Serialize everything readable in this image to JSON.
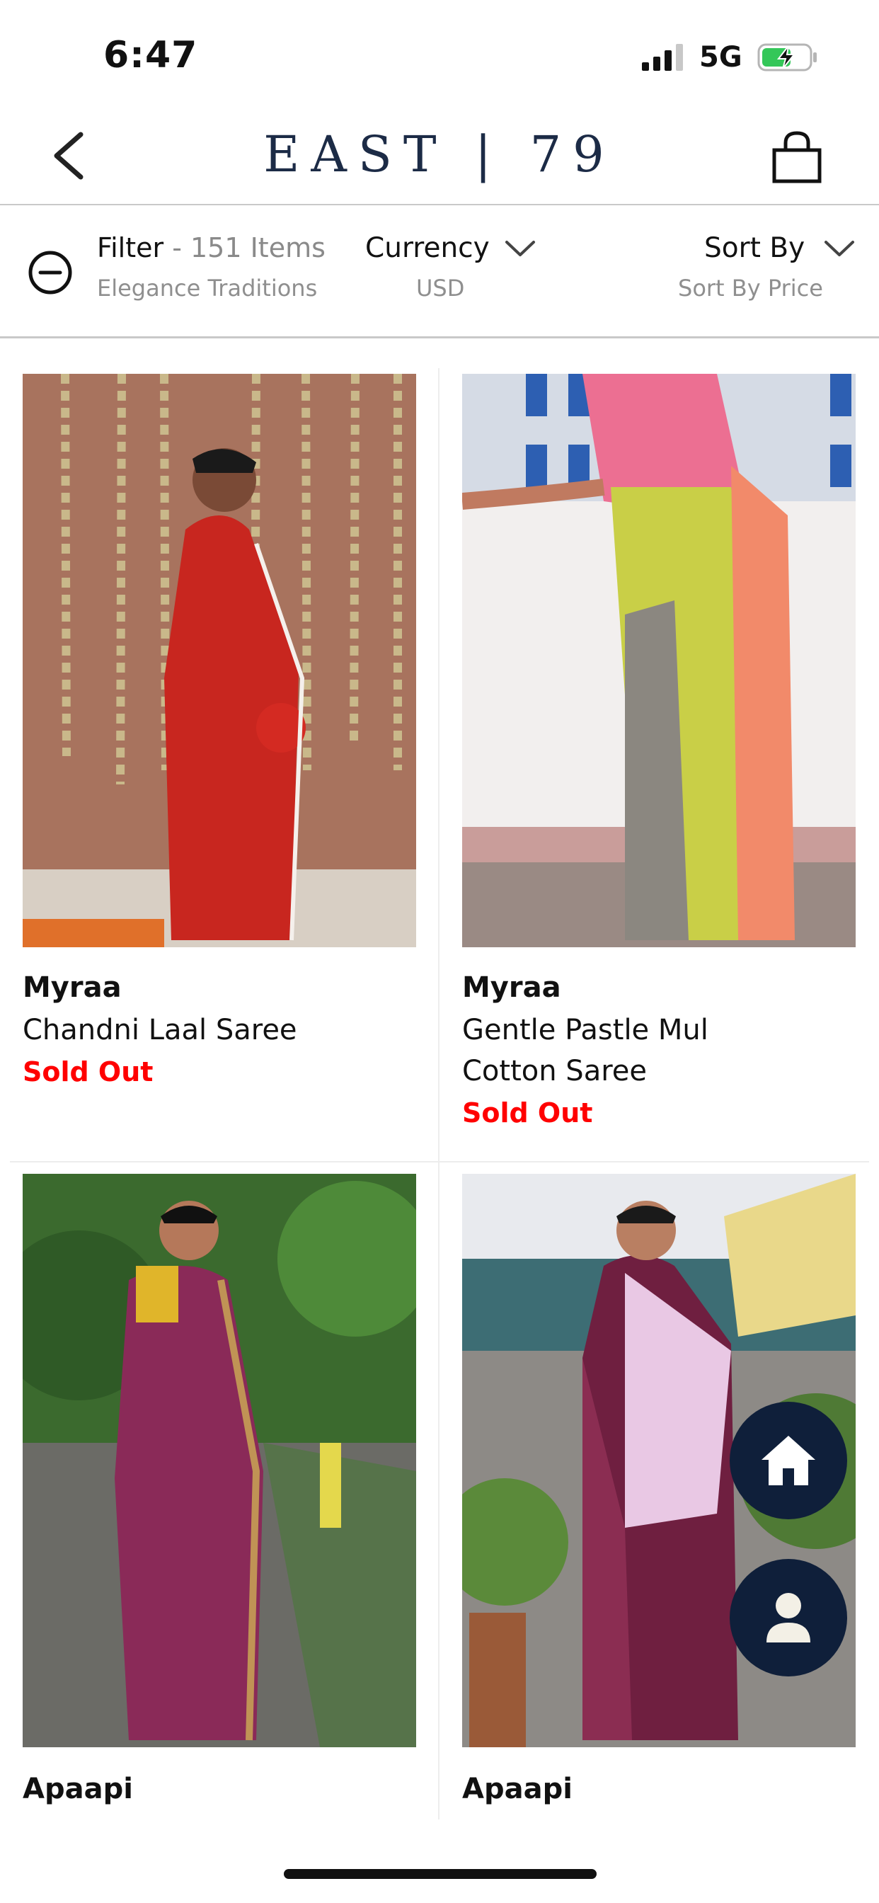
{
  "status_bar": {
    "time": "6:47",
    "network": "5G"
  },
  "header": {
    "brand": "EAST | 79"
  },
  "filter_bar": {
    "filter_label": "Filter",
    "filter_count": " - 151 Items",
    "filter_sub": "Elegance Traditions",
    "currency_label": "Currency",
    "currency_value": "USD",
    "sort_label": "Sort By",
    "sort_value": "Sort By Price"
  },
  "products": [
    {
      "brand": "Myraa",
      "name": "Chandni Laal Saree",
      "status": "Sold Out"
    },
    {
      "brand": "Myraa",
      "name": "Gentle Pastle Mul Cotton Saree",
      "status": "Sold Out"
    },
    {
      "brand": "Apaapi",
      "name": "",
      "status": ""
    },
    {
      "brand": "Apaapi",
      "name": "",
      "status": ""
    }
  ],
  "colors": {
    "brand": "#1c2b46",
    "sold_out": "#ff0000",
    "fab": "#0f1f3a"
  },
  "icons": [
    "back-chevron-icon",
    "shopping-bag-icon",
    "filter-icon",
    "chevron-down-icon",
    "home-icon",
    "user-icon"
  ]
}
